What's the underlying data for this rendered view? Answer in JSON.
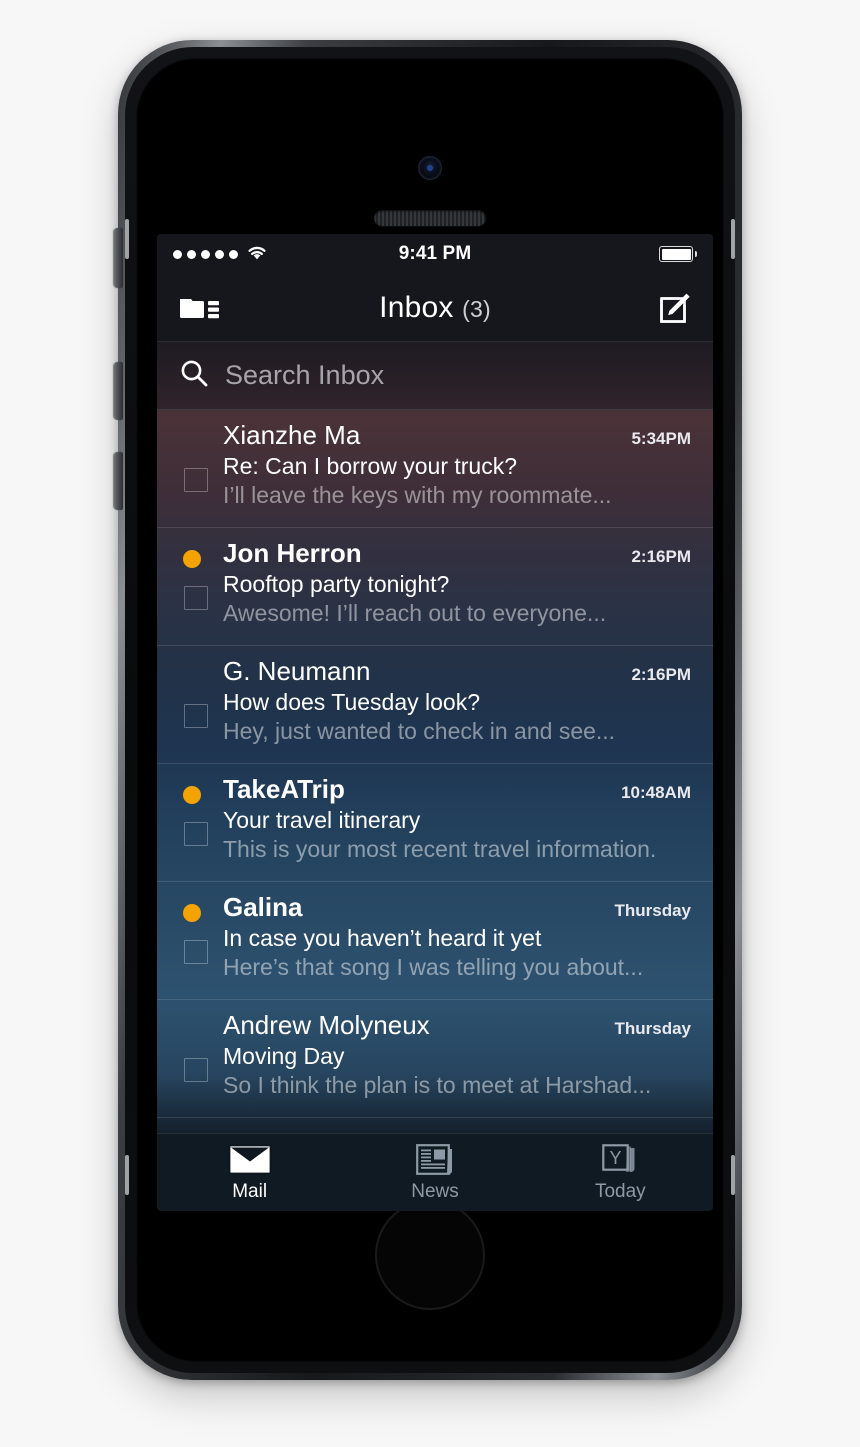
{
  "device": {
    "name": "iPhone"
  },
  "status_bar": {
    "signal_dots": 5,
    "wifi_icon": "wifi-icon",
    "time": "9:41 PM",
    "battery_icon": "battery-full-icon"
  },
  "nav_bar": {
    "folder_icon": "mailboxes-folder-icon",
    "title": "Inbox",
    "unread_count": "(3)",
    "compose_icon": "compose-icon"
  },
  "search": {
    "icon": "search-icon",
    "placeholder": "Search Inbox"
  },
  "messages": [
    {
      "sender": "Xianzhe Ma",
      "time": "5:34PM",
      "subject": "Re: Can I borrow your truck?",
      "preview": "I’ll leave the keys with my roommate...",
      "unread": false,
      "checked": false
    },
    {
      "sender": "Jon Herron",
      "time": "2:16PM",
      "subject": "Rooftop party tonight?",
      "preview": "Awesome! I’ll reach out to everyone...",
      "unread": true,
      "checked": false
    },
    {
      "sender": "G. Neumann",
      "time": "2:16PM",
      "subject": "How does Tuesday look?",
      "preview": "Hey, just wanted to check in and see...",
      "unread": false,
      "checked": false
    },
    {
      "sender": "TakeATrip",
      "time": "10:48AM",
      "subject": "Your travel itinerary",
      "preview": "This is your most recent travel information.",
      "unread": true,
      "checked": false
    },
    {
      "sender": "Galina",
      "time": "Thursday",
      "subject": "In case you haven’t heard it yet",
      "preview": "Here’s that song I was telling you about...",
      "unread": true,
      "checked": false
    },
    {
      "sender": "Andrew Molyneux",
      "time": "Thursday",
      "subject": "Moving Day",
      "preview": "So I think the plan is to meet at Harshad...",
      "unread": false,
      "checked": false
    }
  ],
  "tab_bar": [
    {
      "label": "Mail",
      "icon": "envelope-icon",
      "active": true
    },
    {
      "label": "News",
      "icon": "newspaper-icon",
      "active": false
    },
    {
      "label": "Today",
      "icon": "yahoo-today-icon",
      "active": false
    }
  ],
  "colors": {
    "unread_dot": "#f5a300",
    "chrome": "#16161d",
    "tabbar": "#101a22",
    "text": "#ffffff",
    "preview_text": "#8f8f99",
    "inactive_tab": "#8d9aa5"
  }
}
